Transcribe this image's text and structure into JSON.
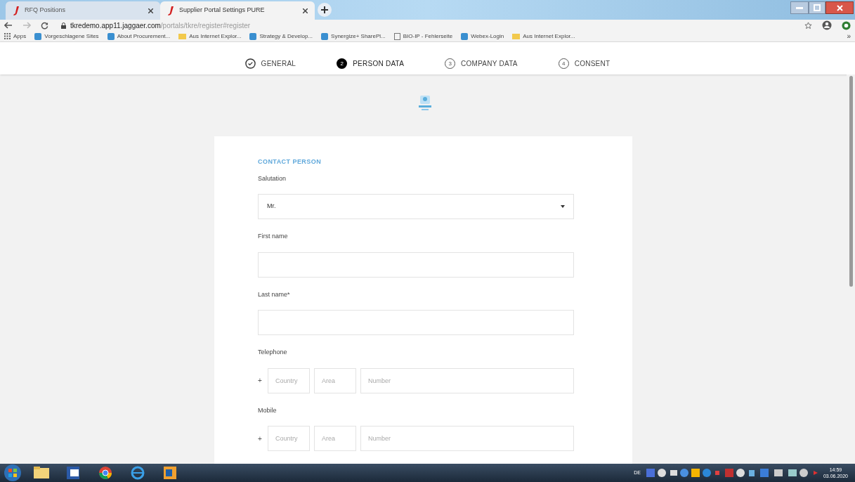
{
  "browser": {
    "tabs": [
      {
        "title": "RFQ Positions",
        "selected": false
      },
      {
        "title": "Supplier Portal Settings PURE",
        "selected": true
      }
    ],
    "url": {
      "host": "tkredemo.app11.jaggaer.com",
      "path": "/portals/tkre/register#register"
    },
    "bookmarks": [
      {
        "label": "Apps",
        "kind": "apps"
      },
      {
        "label": "Vorgeschlagene Sites",
        "kind": "site"
      },
      {
        "label": "About Procurement...",
        "kind": "site"
      },
      {
        "label": "Aus Internet Explor...",
        "kind": "folder"
      },
      {
        "label": "Strategy & Develop...",
        "kind": "site"
      },
      {
        "label": "Synergize+ SharePl...",
        "kind": "site"
      },
      {
        "label": "BIO-IP - Fehlerseite",
        "kind": "page"
      },
      {
        "label": "Webex-Login",
        "kind": "site"
      },
      {
        "label": "Aus Internet Explor...",
        "kind": "folder"
      }
    ],
    "more": "»"
  },
  "steps": [
    {
      "label": "GENERAL",
      "done": true,
      "selected": false
    },
    {
      "label": "PERSON DATA",
      "number": "2",
      "done": false,
      "selected": true
    },
    {
      "label": "COMPANY DATA",
      "number": "3",
      "done": false,
      "selected": false
    },
    {
      "label": "CONSENT",
      "number": "4",
      "done": false,
      "selected": false
    }
  ],
  "form": {
    "section": "CONTACT PERSON",
    "fields": [
      {
        "label": "Salutation",
        "kind": "select",
        "value": "Mr."
      },
      {
        "label": "First name",
        "kind": "text"
      },
      {
        "label": "Last name*",
        "kind": "text"
      },
      {
        "label": "Telephone",
        "kind": "phone",
        "prefix": "+",
        "parts": [
          {
            "placeholder": "Country"
          },
          {
            "placeholder": "Area"
          },
          {
            "placeholder": "Number"
          }
        ]
      },
      {
        "label": "Mobile",
        "kind": "phone",
        "prefix": "+",
        "parts": [
          {
            "placeholder": "Country"
          },
          {
            "placeholder": "Area"
          },
          {
            "placeholder": "Number"
          }
        ]
      }
    ]
  },
  "taskbar": {
    "language": "DE",
    "time": "14:59",
    "date": "03.06.2020"
  }
}
